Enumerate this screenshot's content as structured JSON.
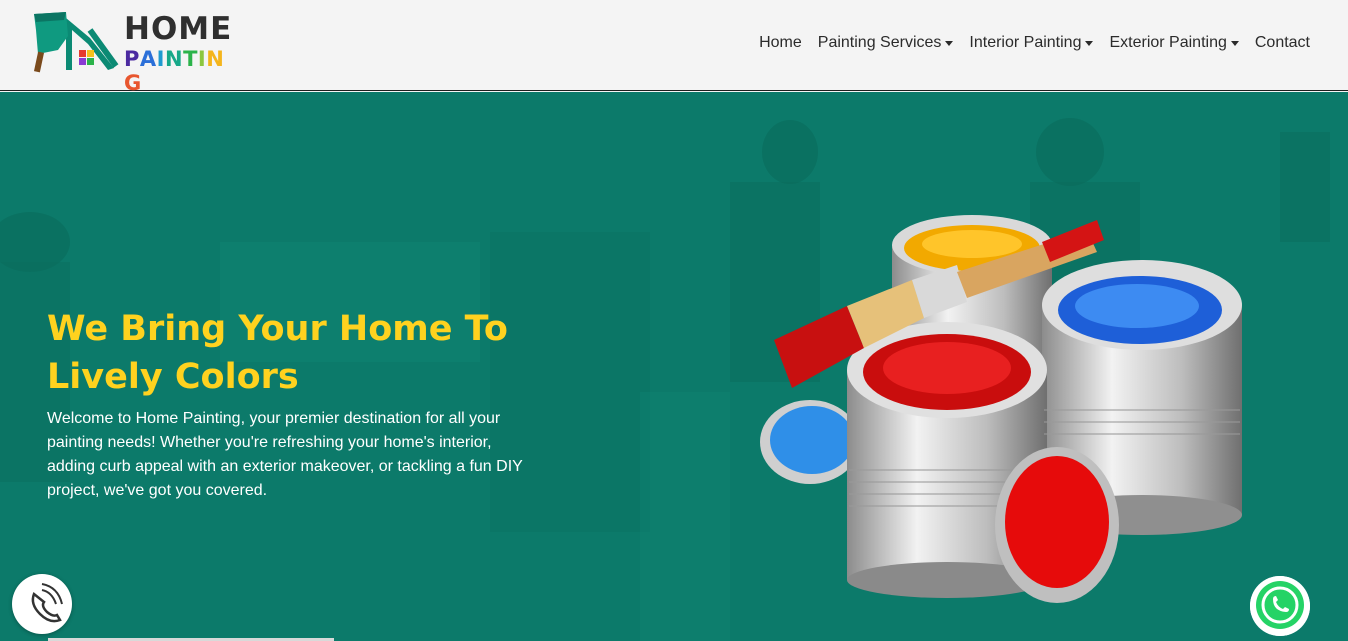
{
  "brand": {
    "name_top": "HOME",
    "name_bottom": "PAINTING",
    "logo_icon": "house-paint-roller-logo"
  },
  "nav": {
    "items": [
      {
        "label": "Home",
        "dropdown": false
      },
      {
        "label": "Painting Services",
        "dropdown": true
      },
      {
        "label": "Interior Painting",
        "dropdown": true
      },
      {
        "label": "Exterior Painting",
        "dropdown": true
      },
      {
        "label": "Contact",
        "dropdown": false
      }
    ]
  },
  "hero": {
    "title": "We Bring Your Home To Lively Colors",
    "text": "Welcome to Home Painting, your premier destination for all your painting needs! Whether you're refreshing your home's interior, adding curb appeal with an exterior makeover, or tackling a fun DIY project, we've got you covered.",
    "image": "paint-cans-with-brush"
  },
  "floating": {
    "call_icon": "phone-icon",
    "whatsapp_icon": "whatsapp-icon"
  },
  "colors": {
    "hero_bg": "#0c7a6a",
    "title": "#ffd21f",
    "logo_teal": "#0b8a74"
  }
}
